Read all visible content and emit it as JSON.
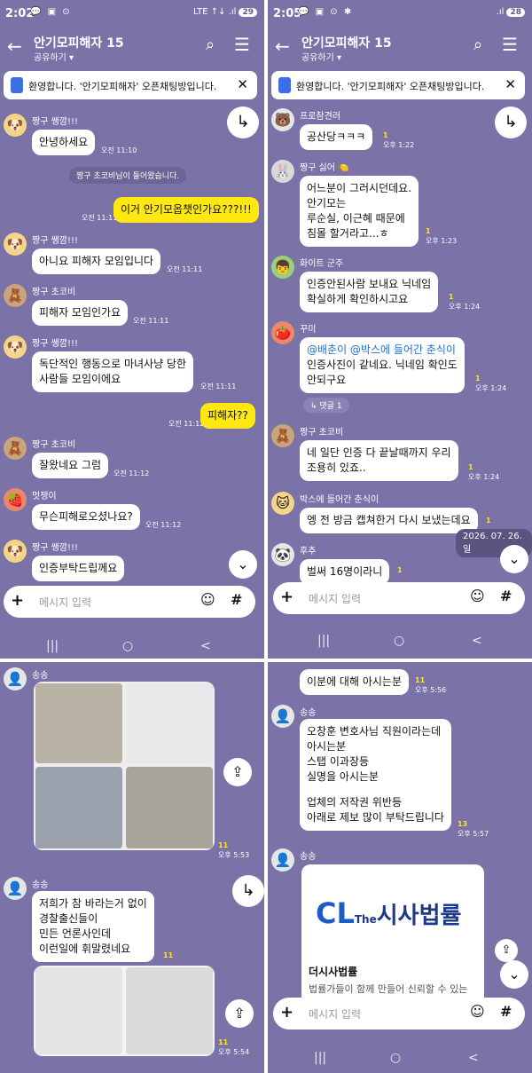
{
  "p1": {
    "status": {
      "time": "2:02",
      "icons": "💬 ▣ ⊙",
      "right": "LTE ↑↓ .ıl",
      "battery": "29"
    },
    "header": {
      "title": "안기모피해자 15",
      "sub": "공유하기 ▾"
    },
    "notice": "환영합니다. '안기모피해자' 오픈채팅방입니다.",
    "msgs": {
      "n1": "짱구 쌩깜!!!",
      "b1": "안녕하세요",
      "t1": "오전 11:10",
      "sys": "짱구 초코비님이 들어왔습니다.",
      "t2": "오전 11:11",
      "b2": "이거 안기모옵챗인가요???!!!",
      "n3": "짱구 쌩깜!!!",
      "b3": "아니요 피해자 모임입니다",
      "t3": "오전 11:11",
      "n4": "짱구 초코비",
      "b4": "피해자 모임인가요",
      "t4": "오전 11:11",
      "n5": "짱구 쌩깜!!!",
      "b5a": "독단적인 행동으로 마녀사냥 당한",
      "b5b": "사람들 모임이에요",
      "t5": "오전 11:11",
      "t6": "오전 11:12",
      "b6": "피해자??",
      "n7": "짱구 초코비",
      "b7": "잘왔네요 그럼",
      "t7": "오전 11:12",
      "n8": "멋쟁이",
      "b8": "무슨피해로오셨나요?",
      "t8": "오전 11:12",
      "n9": "짱구 쌩깜!!!",
      "b9": "인증부탁드립께요"
    },
    "input": "메시지 입력"
  },
  "p2": {
    "status": {
      "time": "2:05",
      "icons": "💬 ▣ ⊙ ✱",
      "right": ".ıl",
      "battery": "28"
    },
    "header": {
      "title": "안기모피해자 15",
      "sub": "공유하기 ▾"
    },
    "notice": "환영합니다. '안기모피해자' 오픈채팅방입니다.",
    "msgs": {
      "n1": "프로참견러",
      "b1": "공산당ㅋㅋㅋ",
      "u1": "1",
      "t1": "오후 1:22",
      "n2": "짱구 싫어 🍋",
      "b2a": "어느분이 그러시던데요.",
      "b2b": "안기모는",
      "b2c": "루순실, 이근혜 때문에",
      "b2d": "침몰 할거라고...ㅎ",
      "u2": "1",
      "t2": "오후 1:23",
      "n3": "화이트 군주",
      "b3a": "인증안된사람 보내요 닉네임",
      "b3b": "확실하게 확인하시고요",
      "u3": "1",
      "t3": "오후 1:24",
      "n4": "꾸미",
      "b4a": "@배춘이 @박스에 들어간 춘식이",
      "b4b": "인증사진이 같네요. 닉네임 확인도",
      "b4c": "안되구요",
      "u4": "1",
      "t4": "오후 1:24",
      "reply": "↳ 댓글 1",
      "n5": "짱구 초코비",
      "b5a": "네 일단 인증 다 끝날때까지 우리",
      "b5b": "조용히 있죠..",
      "u5": "1",
      "t5": "오후 1:24",
      "n6": "박스에 들어간 춘식이",
      "b6": "엥 전 방금 캡쳐한거 다시 보냈는데요",
      "u6": "1",
      "date": "2026. 07. 26. 일",
      "n7": "후추",
      "b7": "벌써 16명이라니",
      "u7": "1"
    },
    "input": "메시지 입력"
  },
  "p3": {
    "msgs": {
      "n1": "송송",
      "u1": "11",
      "t1": "오후 5:53",
      "n2": "송송",
      "b2a": "저희가 참 바라는거 없이",
      "b2b": "경찰출신들이",
      "b2c": "민든 언론사인데",
      "b2d": "이런일에 휘말렸네요",
      "u2": "11",
      "u3": "11",
      "t3": "오후 5:54"
    }
  },
  "p4": {
    "msgs": {
      "b1": "이분에 대해 아시는분",
      "u1": "11",
      "t1": "오후 5:56",
      "n2": "송송",
      "b2a": "오창훈 변호사님 직원이라는데",
      "b2b": "아시는분",
      "b2c": "스탭 이과장등",
      "b2d": "실명을 아시는분",
      "b2e": "업체의 저작권 위반등",
      "b2f": "아래로 제보 많이 부탁드립니다",
      "u2": "13",
      "t2": "오후 5:57",
      "n3": "송송",
      "logo_cl": "CL",
      "logo_the": "The",
      "logo_name": "시사법률",
      "card_title": "더시사법률",
      "card_desc": "법률가들이 함께 만들어 신뢰할 수 있는"
    },
    "input": "메시지 입력"
  },
  "icons": {
    "back": "←",
    "search": "⌕",
    "menu": "☰",
    "close": "✕",
    "share": "↳",
    "down": "⌄",
    "plus": "+",
    "emoji": "☺",
    "hash": "#",
    "nav": [
      "|||",
      "○",
      "<"
    ]
  }
}
